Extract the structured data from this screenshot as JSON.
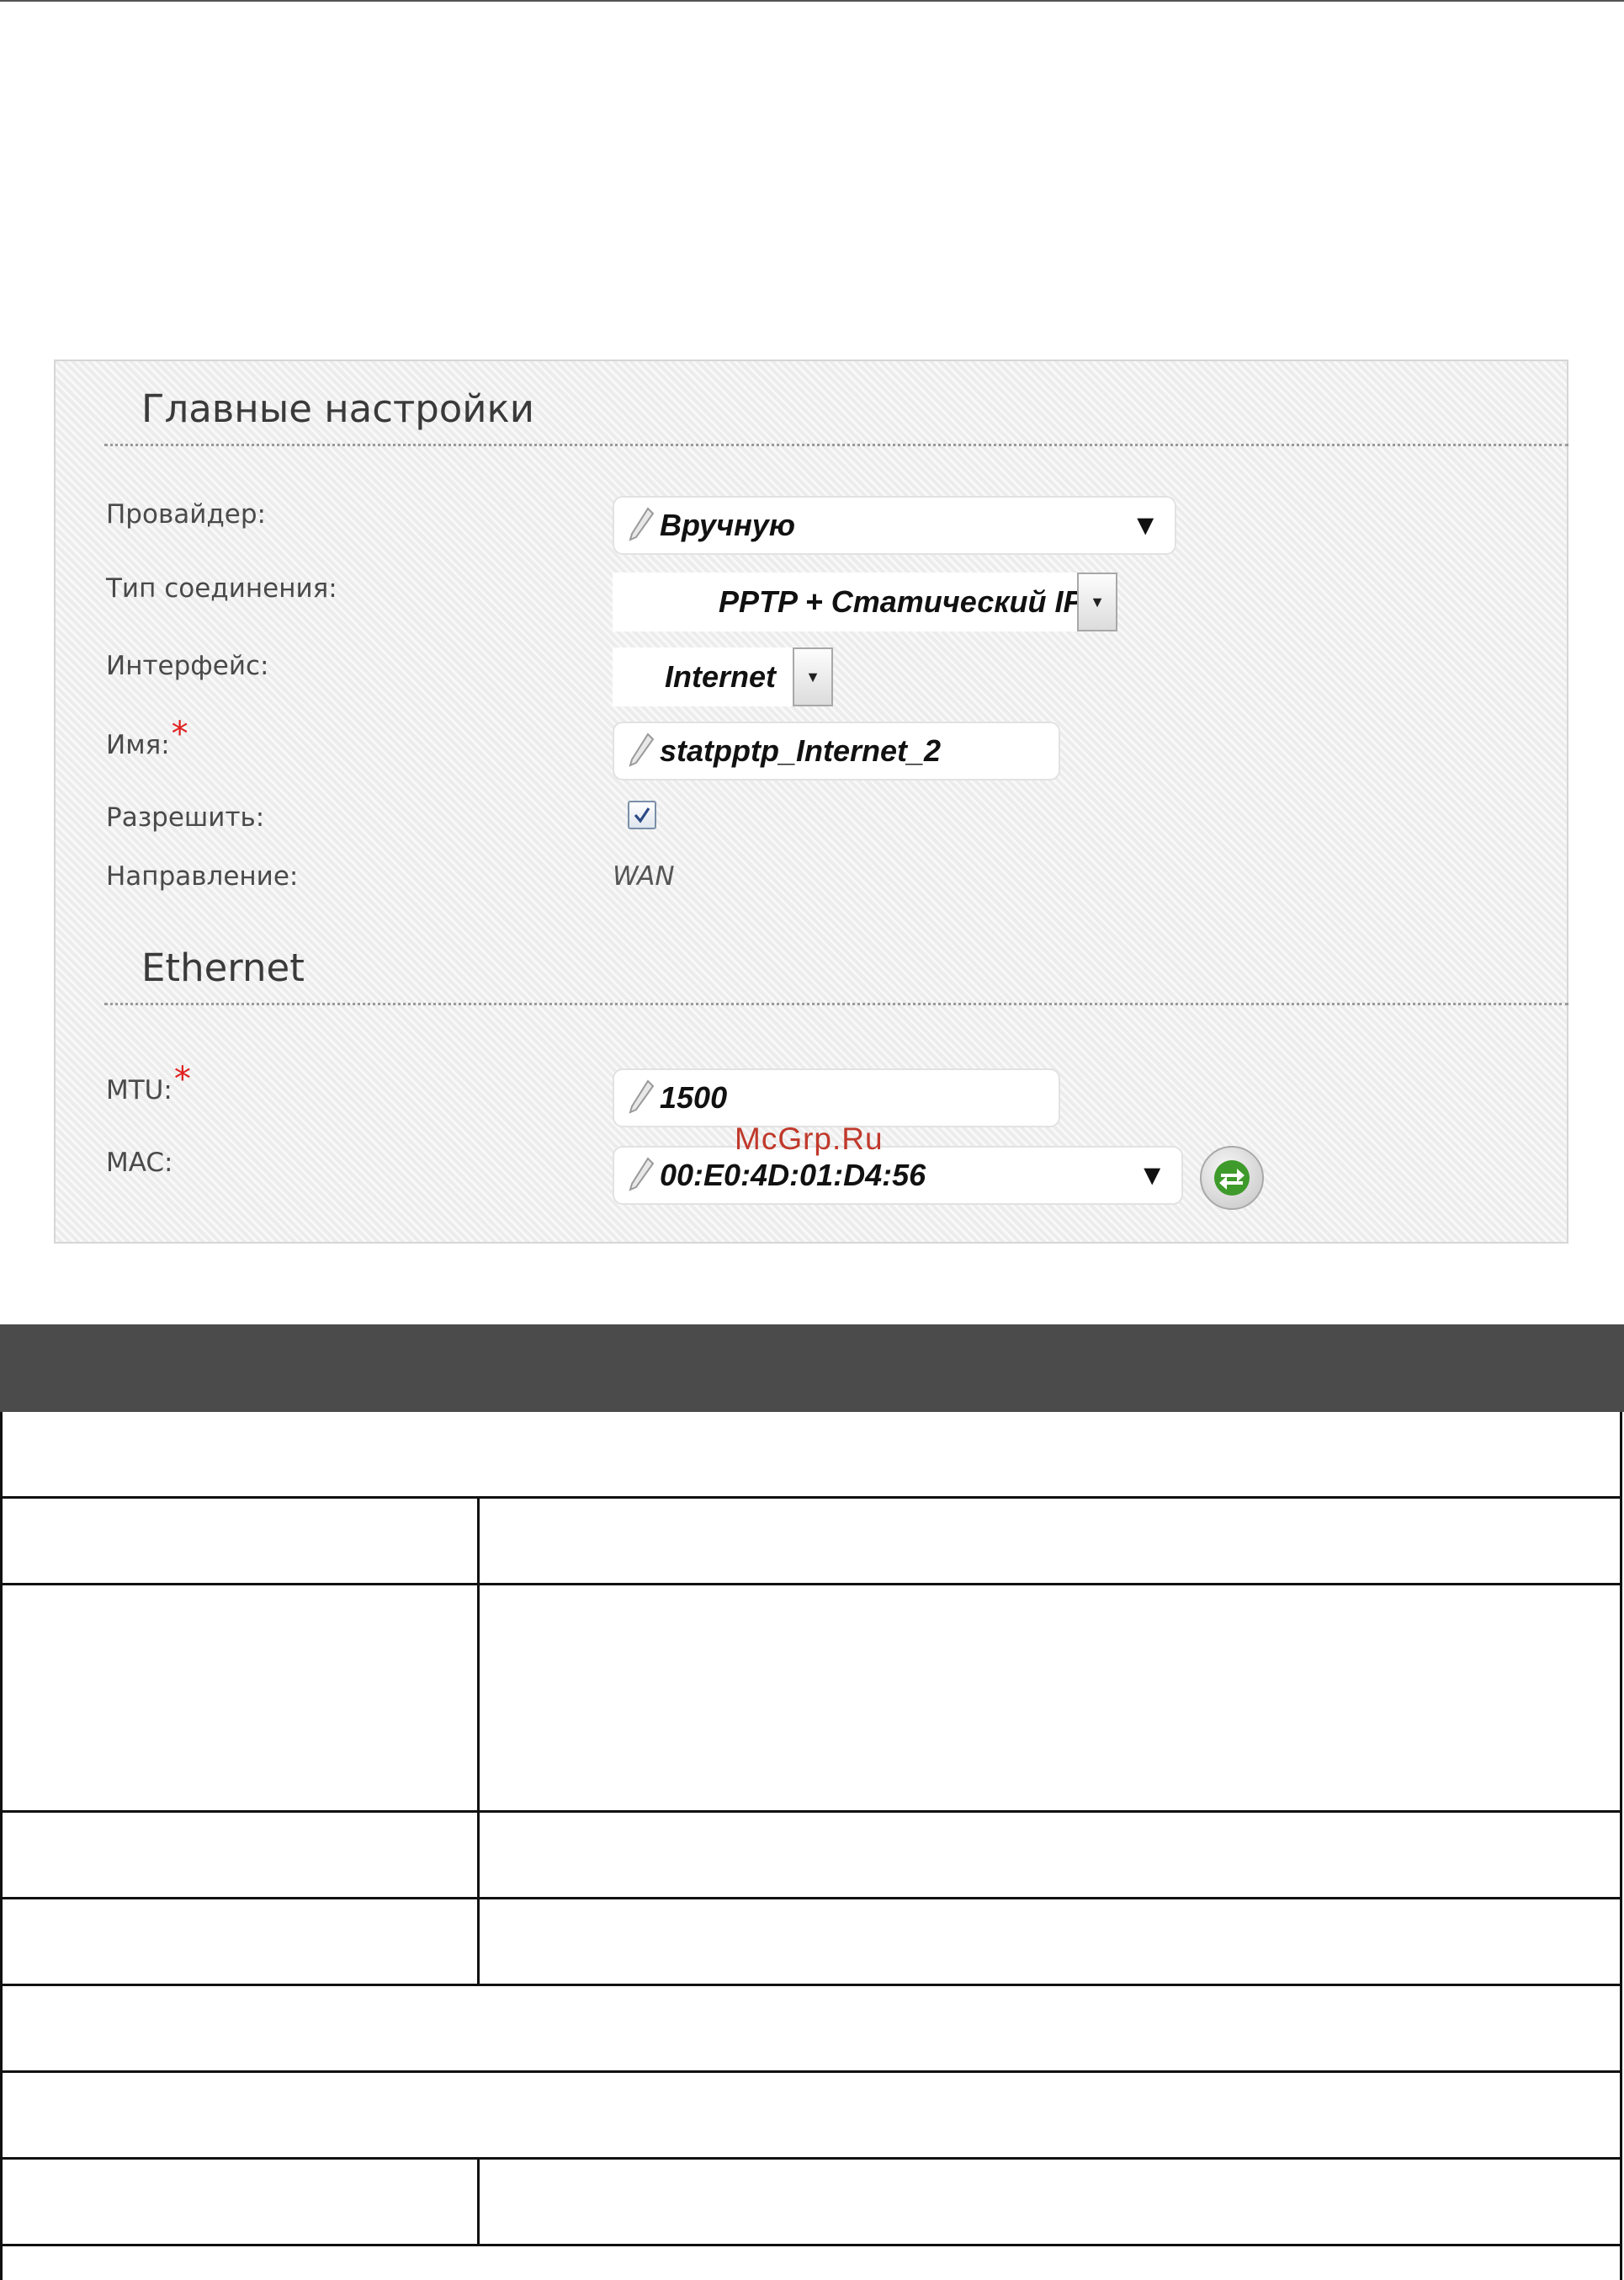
{
  "watermark": "McGrp.Ru",
  "main_settings": {
    "title": "Главные настройки",
    "provider": {
      "label": "Провайдер:",
      "value": "Вручную"
    },
    "connection_type": {
      "label": "Тип соединения:",
      "value": "PPTP + Статический IP"
    },
    "interface": {
      "label": "Интерфейс:",
      "value": "Internet"
    },
    "name": {
      "label": "Имя:",
      "required_mark": "*",
      "value": "statpptp_Internet_2"
    },
    "enable": {
      "label": "Разрешить:",
      "checked": true
    },
    "direction": {
      "label": "Направление:",
      "value": "WAN"
    }
  },
  "ethernet": {
    "title": "Ethernet",
    "mtu": {
      "label": "MTU:",
      "required_mark": "*",
      "value": "1500"
    },
    "mac": {
      "label": "MAC:",
      "value": "00:E0:4D:01:D4:56"
    }
  },
  "icons": [
    "pencil-icon",
    "dropdown-arrow-icon",
    "checkmark-icon",
    "refresh-mac-icon"
  ],
  "colors": {
    "required": "#e02020",
    "table_header": "#4b4b4b",
    "refresh_arrows": "#3e9a2a"
  }
}
